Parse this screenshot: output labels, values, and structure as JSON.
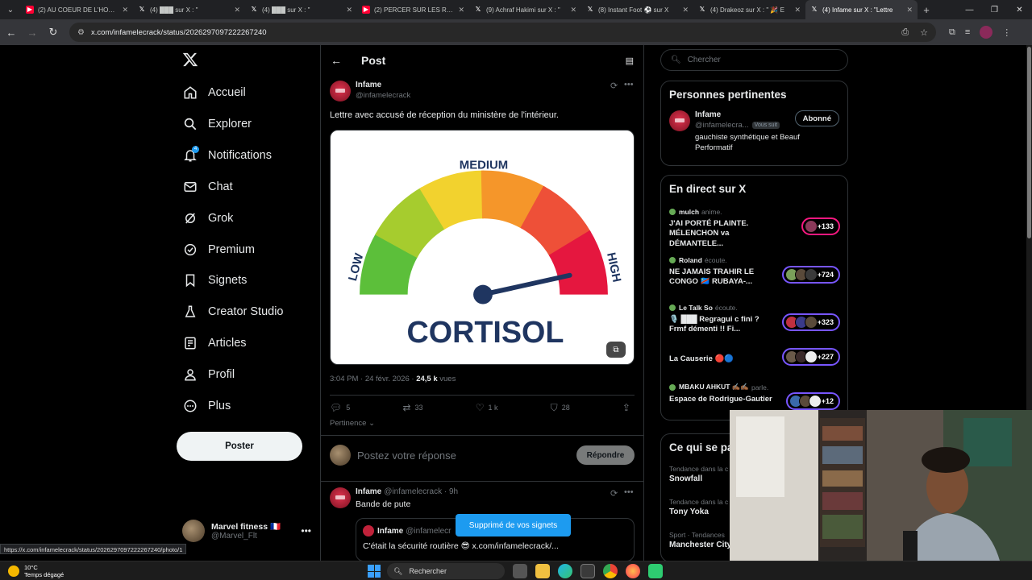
{
  "browser": {
    "tabs": [
      {
        "icon": "youtube-icon",
        "title": "(2) AU COEUR DE L'HOMME"
      },
      {
        "icon": "x-icon",
        "title": "(4) ███ sur X : \""
      },
      {
        "icon": "x-icon",
        "title": "(4) ███ sur X : \""
      },
      {
        "icon": "youtube-icon",
        "title": "(2) PERCER SUR LES RÉSE"
      },
      {
        "icon": "x-icon",
        "title": "(9) Achraf Hakimi sur X : \""
      },
      {
        "icon": "x-icon",
        "title": "(8) Instant Foot ⚽ sur X"
      },
      {
        "icon": "x-icon",
        "title": "(4) Drakeoz sur X : \" 🎉 E"
      },
      {
        "icon": "x-icon",
        "title": "(4) Infame sur X : \"Lettre"
      }
    ],
    "active_tab": 7,
    "url": "x.com/infamelecrack/status/2026297097222267240",
    "status_url": "https://x.com/infamelecrack/status/2026297097222267240/photo/1"
  },
  "nav": {
    "items": [
      {
        "label": "Accueil",
        "icon": "home-icon"
      },
      {
        "label": "Explorer",
        "icon": "search-icon"
      },
      {
        "label": "Notifications",
        "icon": "bell-icon",
        "badge": "4"
      },
      {
        "label": "Chat",
        "icon": "mail-icon"
      },
      {
        "label": "Grok",
        "icon": "grok-icon"
      },
      {
        "label": "Premium",
        "icon": "verified-icon"
      },
      {
        "label": "Signets",
        "icon": "bookmark-icon"
      },
      {
        "label": "Creator Studio",
        "icon": "flask-icon"
      },
      {
        "label": "Articles",
        "icon": "article-icon"
      },
      {
        "label": "Profil",
        "icon": "profile-icon"
      },
      {
        "label": "Plus",
        "icon": "more-circle-icon"
      }
    ],
    "post_button": "Poster",
    "account": {
      "name": "Marvel fitness 🇫🇷",
      "handle": "@Marvel_Flt"
    }
  },
  "post": {
    "header_title": "Post",
    "author_name": "Infame",
    "author_handle": "@infamelecrack",
    "text": "Lettre avec accusé de réception du ministère de l'intérieur.",
    "image_labels": {
      "low": "LOW",
      "medium": "MEDIUM",
      "high": "HIGH",
      "caption": "CORTISOL"
    },
    "gauge_level": 0.93,
    "gauge_colors": [
      "#5cbf3a",
      "#a6cc2e",
      "#f2d22e",
      "#f5962a",
      "#ee5038",
      "#e5173f"
    ],
    "meta_time": "3:04 PM · 24 févr. 2026 · ",
    "meta_views_count": "24,5 k",
    "meta_views_label": " vues",
    "counts": {
      "replies": "5",
      "reposts": "33",
      "likes": "1 k",
      "bookmarks": "28"
    },
    "sort_label": "Pertinence",
    "reply_placeholder": "Postez votre réponse",
    "reply_button": "Répondre"
  },
  "reply": {
    "name": "Infame",
    "handle": "@infamelecrack · 9h",
    "text": "Bande de pute",
    "quote_name": "Infame",
    "quote_handle": "@infamelecr",
    "quote_text": "C'était la sécurité routière 😎 x.com/infamelecrack/..."
  },
  "toast": "Supprimé de vos signets",
  "search_placeholder": "Chercher",
  "relevant": {
    "title": "Personnes pertinentes",
    "name": "Infame",
    "handle": "@infamelecra...",
    "follows_you": "Vous suit",
    "follow_button": "Abonné",
    "bio": "gauchiste synthétique et Beauf Performatif"
  },
  "live": {
    "title": "En direct sur X",
    "items": [
      {
        "host": "mulch",
        "status": "anime.",
        "title": "J'AI PORTÉ PLAINTE. MÉLENCHON va DÉMANTELE...",
        "count": "+133"
      },
      {
        "host": "Roland",
        "status": "écoute.",
        "title": "NE JAMAIS TRAHIR LE CONGO 🇨🇩 RUBAYA-...",
        "count": "+724"
      },
      {
        "host": "Le Talk So",
        "status": "écoute.",
        "title": "🎙️ ███ Regragui c fini ? Frmf démenti !! Fi...",
        "count": "+323"
      },
      {
        "host": "",
        "status": "",
        "title": "La Causerie 🔴🔵",
        "count": "+227"
      },
      {
        "host": "MBAKU AHKUT ✍🏾✍🏾",
        "status": "parle.",
        "title": "Espace de Rodrigue-Gautier",
        "count": "+12"
      }
    ]
  },
  "trends": {
    "title": "Ce qui se passe",
    "items": [
      {
        "label": "Tendance dans la c",
        "name": "Snowfall"
      },
      {
        "label": "Tendance dans la c",
        "name": "Tony Yoka"
      },
      {
        "label": "Sport · Tendances",
        "name": "Manchester City"
      }
    ]
  },
  "taskbar": {
    "temp": "10°C",
    "weather": "Temps dégagé",
    "search": "Rechercher"
  }
}
